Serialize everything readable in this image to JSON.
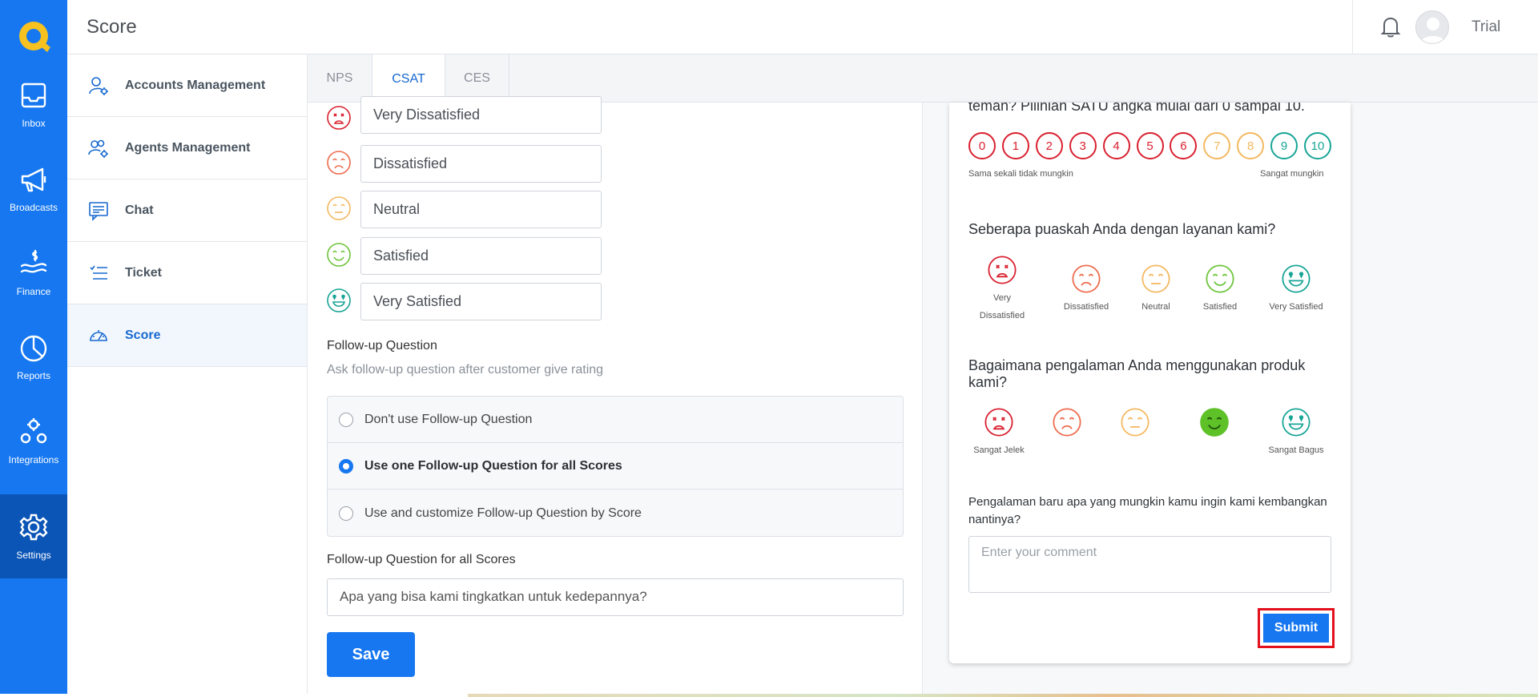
{
  "app": {
    "page_title": "Score"
  },
  "rail": {
    "items": [
      {
        "label": "Inbox",
        "icon": "inbox-icon"
      },
      {
        "label": "Broadcasts",
        "icon": "megaphone-icon"
      },
      {
        "label": "Finance",
        "icon": "finance-icon"
      },
      {
        "label": "Reports",
        "icon": "pie-chart-icon"
      },
      {
        "label": "Integrations",
        "icon": "integrations-icon"
      },
      {
        "label": "Settings",
        "icon": "gear-icon"
      }
    ]
  },
  "header": {
    "user_name": "Trial"
  },
  "subnav": {
    "items": [
      {
        "label": "Accounts Management"
      },
      {
        "label": "Agents Management"
      },
      {
        "label": "Chat"
      },
      {
        "label": "Ticket"
      },
      {
        "label": "Score"
      }
    ]
  },
  "tabs": [
    {
      "label": "NPS"
    },
    {
      "label": "CSAT"
    },
    {
      "label": "CES"
    }
  ],
  "form": {
    "faces": [
      {
        "value": "Very Dissatisfied",
        "color": "#d9202f"
      },
      {
        "value": "Dissatisfied",
        "color": "#ee6b4d"
      },
      {
        "value": "Neutral",
        "color": "#f4b860"
      },
      {
        "value": "Satisfied",
        "color": "#6cc43a"
      },
      {
        "value": "Very Satisfied",
        "color": "#17a596"
      }
    ],
    "followup_title": "Follow-up Question",
    "followup_sub": "Ask follow-up question after customer give rating",
    "options": [
      {
        "label": "Don't use Follow-up Question"
      },
      {
        "label": "Use one Follow-up Question for all Scores"
      },
      {
        "label": "Use and customize Follow-up Question by Score"
      }
    ],
    "all_scores_title": "Follow-up Question for all Scores",
    "all_scores_value": "Apa yang bisa kami tingkatkan untuk kedepannya?",
    "save_label": "Save"
  },
  "preview": {
    "nps_question_tail": "teman? Pilihlah SATU angka mulai dari 0 sampai 10.",
    "nps_numbers": [
      "0",
      "1",
      "2",
      "3",
      "4",
      "5",
      "6",
      "7",
      "8",
      "9",
      "10"
    ],
    "nps_left_label": "Sama sekali tidak mungkin",
    "nps_right_label": "Sangat mungkin",
    "csat_question": "Seberapa puaskah Anda dengan layanan kami?",
    "csat_labels": [
      "Very Dissatisfied",
      "Dissatisfied",
      "Neutral",
      "Satisfied",
      "Very Satisfied"
    ],
    "ces_question": "Bagaimana pengalaman Anda menggunakan produk kami?",
    "ces_left_label": "Sangat Jelek",
    "ces_right_label": "Sangat Bagus",
    "comment_question": "Pengalaman baru apa yang mungkin kamu ingin kami kembangkan nantinya?",
    "comment_placeholder": "Enter your comment",
    "submit_label": "Submit"
  },
  "colors": {
    "brand": "#1677f0",
    "rail_active": "#0b55b7",
    "nps_red": "#d9202f",
    "nps_yellow": "#f4b860",
    "nps_teal": "#17a596"
  }
}
